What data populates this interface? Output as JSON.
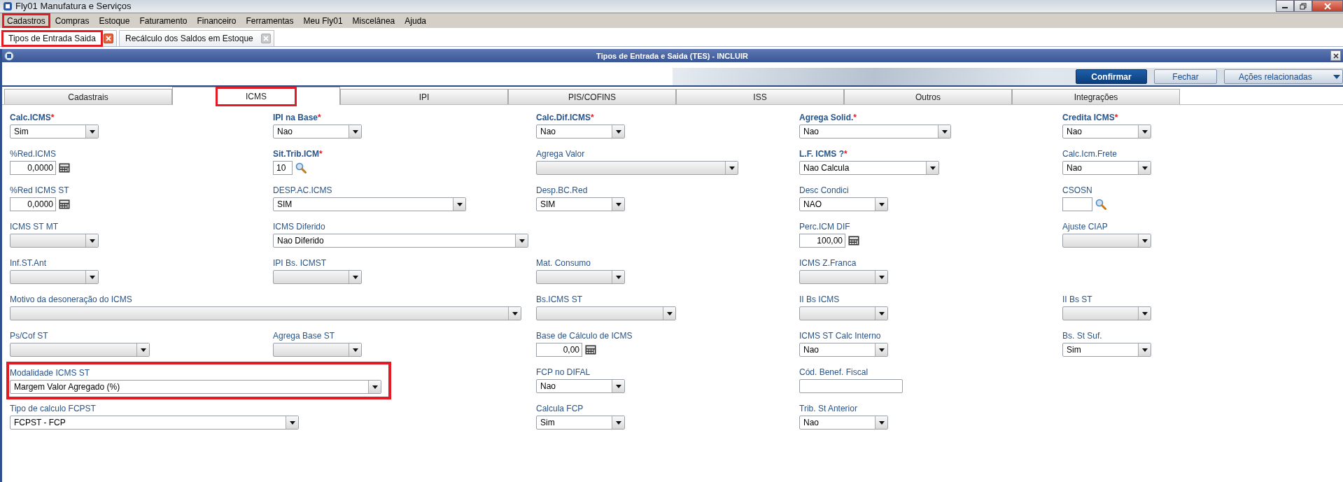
{
  "app": {
    "title": "Fly01 Manufatura e Serviços"
  },
  "menu": [
    {
      "label": "Cadastros",
      "highlighted": true
    },
    {
      "label": "Compras",
      "highlighted": false
    },
    {
      "label": "Estoque",
      "highlighted": false
    },
    {
      "label": "Faturamento",
      "highlighted": false
    },
    {
      "label": "Financeiro",
      "highlighted": false
    },
    {
      "label": "Ferramentas",
      "highlighted": false
    },
    {
      "label": "Meu Fly01",
      "highlighted": false
    },
    {
      "label": "Miscelânea",
      "highlighted": false
    },
    {
      "label": "Ajuda",
      "highlighted": false
    }
  ],
  "doc_tabs": [
    {
      "label": "Tipos de Entrada Saida",
      "selected": true,
      "highlighted": true
    },
    {
      "label": "Recálculo dos Saldos em Estoque",
      "selected": false,
      "highlighted": false
    }
  ],
  "dialog": {
    "title": "Tipos de Entrada e Saida (TES) - INCLUIR",
    "buttons": [
      {
        "label": "Confirmar",
        "kind": "primary"
      },
      {
        "label": "Fechar",
        "kind": "secondary"
      },
      {
        "label": "Ações relacionadas",
        "kind": "menu"
      }
    ]
  },
  "tabs": [
    {
      "label": "Cadastrais",
      "selected": false,
      "highlighted": false
    },
    {
      "label": "ICMS",
      "selected": true,
      "highlighted": true
    },
    {
      "label": "IPI",
      "selected": false,
      "highlighted": false
    },
    {
      "label": "PIS/COFINS",
      "selected": false,
      "highlighted": false
    },
    {
      "label": "ISS",
      "selected": false,
      "highlighted": false
    },
    {
      "label": "Outros",
      "selected": false,
      "highlighted": false
    },
    {
      "label": "Integrações",
      "selected": false,
      "highlighted": false
    }
  ],
  "form_rows": [
    [
      {
        "label": "Calc.ICMS",
        "asterisk": "*",
        "kind": "select",
        "value": "Sim"
      },
      {
        "label": "IPI na Base",
        "asterisk": "*",
        "kind": "select",
        "value": "Nao"
      },
      {
        "label": "Calc.Dif.ICMS",
        "asterisk": "*",
        "kind": "select",
        "value": "Nao"
      },
      {
        "label": "Agrega Solid.",
        "asterisk": "*",
        "kind": "select",
        "value": "Nao"
      },
      {
        "label": "Credita ICMS",
        "asterisk": "*",
        "kind": "select",
        "value": "Nao"
      }
    ],
    [
      {
        "label": "%Red.ICMS",
        "kind": "number",
        "value": "0,0000"
      },
      {
        "label": "Sit.Trib.ICM",
        "asterisk": "*",
        "kind": "lookup",
        "value": "10"
      },
      {
        "label": "Agrega Valor",
        "kind": "select"
      },
      {
        "label": "L.F. ICMS ?",
        "asterisk": "*",
        "kind": "select",
        "value": "Nao Calcula"
      },
      {
        "label": "Calc.Icm.Frete",
        "kind": "select",
        "value": "Nao"
      }
    ],
    [
      {
        "label": "%Red ICMS ST",
        "kind": "number",
        "value": "0,0000"
      },
      {
        "label": "DESP.AC.ICMS",
        "kind": "select",
        "value": "SIM"
      },
      {
        "label": "Desp.BC.Red",
        "kind": "select",
        "value": "SIM"
      },
      {
        "label": "Desc Condici",
        "kind": "select",
        "value": "NAO"
      },
      {
        "label": "CSOSN",
        "kind": "lookup"
      }
    ],
    [
      {
        "label": "ICMS ST MT",
        "kind": "select"
      },
      {
        "label": "ICMS Diferido",
        "kind": "select",
        "value": "Nao Diferido"
      },
      null,
      {
        "label": "Perc.ICM DIF",
        "kind": "number",
        "value": "100,00"
      },
      {
        "label": "Ajuste CIAP",
        "kind": "select"
      }
    ],
    [
      {
        "label": "Inf.ST.Ant",
        "kind": "select"
      },
      {
        "label": "IPI Bs. ICMST",
        "kind": "select"
      },
      {
        "label": "Mat. Consumo",
        "kind": "select"
      },
      {
        "label": "ICMS Z.Franca",
        "kind": "select"
      }
    ],
    [
      {
        "label": "Motivo da desoneração do ICMS",
        "kind": "select"
      },
      {
        "label": "Bs.ICMS ST",
        "kind": "select"
      },
      {
        "label": "II Bs ICMS",
        "kind": "select"
      },
      {
        "label": "II Bs ST",
        "kind": "select"
      }
    ],
    [
      {
        "label": "Ps/Cof ST",
        "kind": "select"
      },
      {
        "label": "Agrega Base ST",
        "kind": "select"
      },
      {
        "label": "Base de Cálculo de ICMS",
        "kind": "number",
        "value": "0,00"
      },
      {
        "label": "ICMS ST Calc Interno",
        "kind": "select",
        "value": "Nao"
      },
      {
        "label": "Bs. St Suf.",
        "kind": "select",
        "value": "Sim"
      }
    ],
    [
      {
        "label": "Modalidade ICMS ST",
        "kind": "select",
        "value": "Margem Valor Agregado (%)",
        "highlighted": true
      },
      {
        "label": "FCP no DIFAL",
        "kind": "select",
        "value": "Nao"
      },
      {
        "label": "Cód. Benef. Fiscal",
        "kind": "text"
      }
    ],
    [
      {
        "label": "Tipo de calculo FCPST",
        "kind": "select",
        "value": "FCPST -  FCP"
      },
      {
        "label": "Calcula FCP",
        "kind": "select",
        "value": "Sim"
      },
      {
        "label": "Trib. St Anterior",
        "kind": "select",
        "value": "Nao"
      }
    ]
  ]
}
